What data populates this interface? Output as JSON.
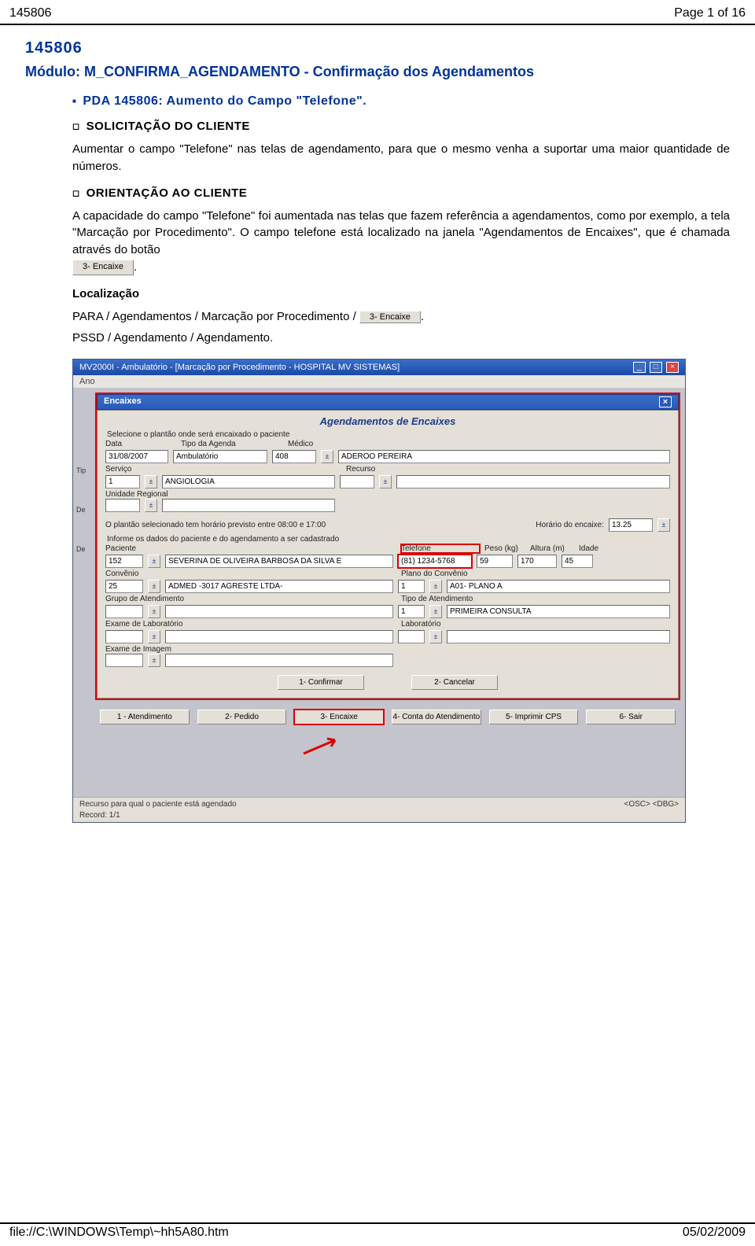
{
  "header": {
    "left": "145806",
    "right": "Page 1 of 16"
  },
  "footer": {
    "left": "file://C:\\WINDOWS\\Temp\\~hh5A80.htm",
    "right": "05/02/2009"
  },
  "doc": {
    "code": "145806",
    "module": "Módulo: M_CONFIRMA_AGENDAMENTO - Confirmação dos Agendamentos",
    "pda": "PDA 145806: Aumento do Campo \"Telefone\".",
    "solic_head": "SOLICITAÇÃO DO CLIENTE",
    "solic_body": "Aumentar o campo \"Telefone\" nas telas de agendamento, para que o mesmo venha a suportar uma maior quantidade de números.",
    "orient_head": "ORIENTAÇÃO AO CLIENTE",
    "orient_body1": "A capacidade do campo \"Telefone\" foi aumentada nas telas que fazem referência a agendamentos, como por exemplo, a tela \"Marcação por Procedimento\". O campo telefone está localizado na janela \"Agendamentos de Encaixes\", que é chamada através do botão",
    "orient_body_suffix": ".",
    "encaixe_btn": "3- Encaixe",
    "loc_head": "Localização",
    "loc_path1_prefix": "PARA / Agendamentos / Marcação por Procedimento / ",
    "loc_path1_suffix": ".",
    "loc_path2": "PSSD / Agendamento / Agendamento."
  },
  "ss": {
    "app_title": "MV2000I - Ambulatório - [Marcação por Procedimento - HOSPITAL MV SISTEMAS]",
    "menu": "Ano",
    "inner_title": "Encaixes",
    "dialog_title": "Agendamentos de Encaixes",
    "group1": "Selecione o plantão onde será encaixado o paciente",
    "labels": {
      "data": "Data",
      "tipo_agenda": "Tipo da Agenda",
      "medico": "Médico",
      "servico": "Serviço",
      "recurso": "Recurso",
      "unidade": "Unidade Regional",
      "horario_info": "O plantão selecionado tem horário previsto entre  08:00 e 17:00",
      "horario_encaixe": "Horário do encaixe:",
      "group2": "Informe os dados do paciente e do agendamento a ser cadastrado",
      "paciente": "Paciente",
      "telefone": "Telefone",
      "peso": "Peso (kg)",
      "altura": "Altura (m)",
      "idade": "Idade",
      "convenio": "Convênio",
      "plano": "Plano do Convênio",
      "grupo_at": "Grupo de Atendimento",
      "tipo_at": "Tipo de Atendimento",
      "exame_lab": "Exame de Laboratório",
      "laboratorio": "Laboratório",
      "exame_img": "Exame de Imagem"
    },
    "values": {
      "data": "31/08/2007",
      "tipo_agenda": "Ambulatório",
      "medico_id": "408",
      "medico": "ADEROO PEREIRA",
      "servico_id": "1",
      "servico": "ANGIOLOGIA",
      "recurso": "",
      "unidade": "",
      "horario": "13.25",
      "paciente_id": "152",
      "paciente": "SEVERINA DE OLIVEIRA BARBOSA DA SILVA E",
      "telefone": "(81) 1234-5768",
      "peso": "59",
      "altura": "170",
      "idade": "45",
      "convenio_id": "25",
      "convenio": "ADMED -3017  AGRESTE  LTDA-",
      "plano_id": "1",
      "plano": "A01- PLANO A",
      "grupo_at": "",
      "tipo_at_id": "1",
      "tipo_at": "PRIMEIRA CONSULTA",
      "exame_lab": "",
      "laboratorio": "",
      "exame_img": ""
    },
    "buttons": {
      "confirmar": "1- Confirmar",
      "cancelar": "2- Cancelar",
      "atendimento": "1 - Atendimento",
      "pedido": "2- Pedido",
      "encaixe": "3- Encaixe",
      "conta": "4- Conta do Atendimento",
      "imprimir": "5- Imprimir CPS",
      "sair": "6- Sair"
    },
    "status": {
      "left": "Recurso para qual o paciente está agendado",
      "record": "Record: 1/1",
      "right": "<OSC>  <DBG>"
    },
    "side": {
      "tip": "Tip",
      "de1": "De",
      "de2": "De"
    }
  }
}
